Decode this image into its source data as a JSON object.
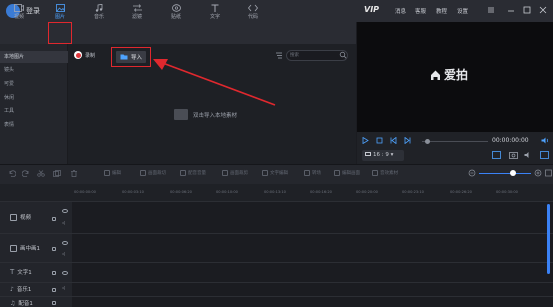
{
  "titlebar": {
    "login": "登录",
    "vip": "VIP",
    "menu": [
      "消息",
      "客服",
      "教程",
      "设置"
    ]
  },
  "tabs": [
    {
      "label": "视频",
      "icon": "video-icon"
    },
    {
      "label": "图片",
      "icon": "image-icon",
      "active": true
    },
    {
      "label": "音乐",
      "icon": "music-icon"
    },
    {
      "label": "滤镜",
      "icon": "filter-icon"
    },
    {
      "label": "贴纸",
      "icon": "sticker-icon"
    },
    {
      "label": "文字",
      "icon": "text-icon"
    },
    {
      "label": "代码",
      "icon": "code-icon"
    }
  ],
  "categories": [
    "本地图片",
    "镜头",
    "可爱",
    "休闲",
    "工具",
    "表情"
  ],
  "media": {
    "record_label": "录制",
    "import_label": "导入",
    "search_placeholder": "搜索",
    "empty_hint": "双击导入本地素材"
  },
  "preview": {
    "brand": "爱拍",
    "timecode": "00:00:00:00",
    "ratio": "16 : 9"
  },
  "toolbar": [
    "编辑",
    "画面裁切",
    "配音音量",
    "画面裁剪",
    "文字编辑",
    "转场",
    "编辑画面",
    "音效素材"
  ],
  "ruler": [
    "00:00:00:00",
    "00:00:03:10",
    "00:00:06:20",
    "00:00:10:00",
    "00:00:13:10",
    "00:00:16:20",
    "00:00:20:00",
    "00:00:23:10",
    "00:00:26:20",
    "00:00:30:00"
  ],
  "tracks": [
    {
      "label": "视频",
      "icon": "video-track-icon"
    },
    {
      "label": "画中画1",
      "icon": "pip-track-icon"
    },
    {
      "label": "文字1",
      "icon": "text-track-icon"
    },
    {
      "label": "音乐1",
      "icon": "music-track-icon"
    },
    {
      "label": "配音1",
      "icon": "voice-track-icon"
    }
  ],
  "colors": {
    "accent": "#3b82f6",
    "highlight": "#e0282e",
    "active_tab": "#4ea3ff"
  }
}
